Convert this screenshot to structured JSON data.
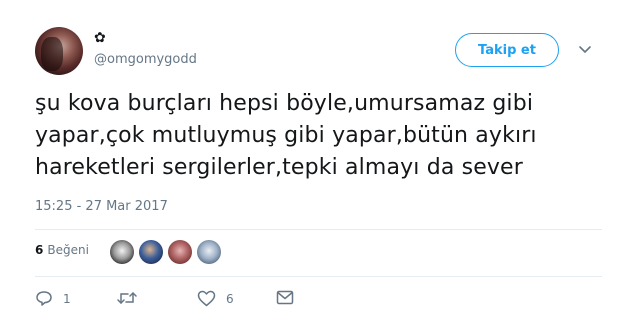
{
  "user": {
    "display_name": "✿",
    "username": "@omgomygodd",
    "avatar_icon": "profile-photo"
  },
  "header": {
    "follow_label": "Takip et",
    "menu_icon": "chevron-down-icon"
  },
  "tweet": {
    "line1": "şu kova burçları hepsi böyle,umursamaz gibi",
    "line2": "yapar,çok mutluymuş gibi yapar,bütün aykırı",
    "line3": "hareketleri sergilerler,tepki almayı da sever",
    "timestamp": "15:25 - 27 Mar 2017"
  },
  "likes": {
    "count": "6",
    "label": "Beğeni"
  },
  "actions": {
    "reply_count": "1",
    "retweet_count": "",
    "like_count": "6"
  },
  "colors": {
    "accent": "#1da1f2",
    "muted": "#657786",
    "divider": "#e6ecf0"
  }
}
